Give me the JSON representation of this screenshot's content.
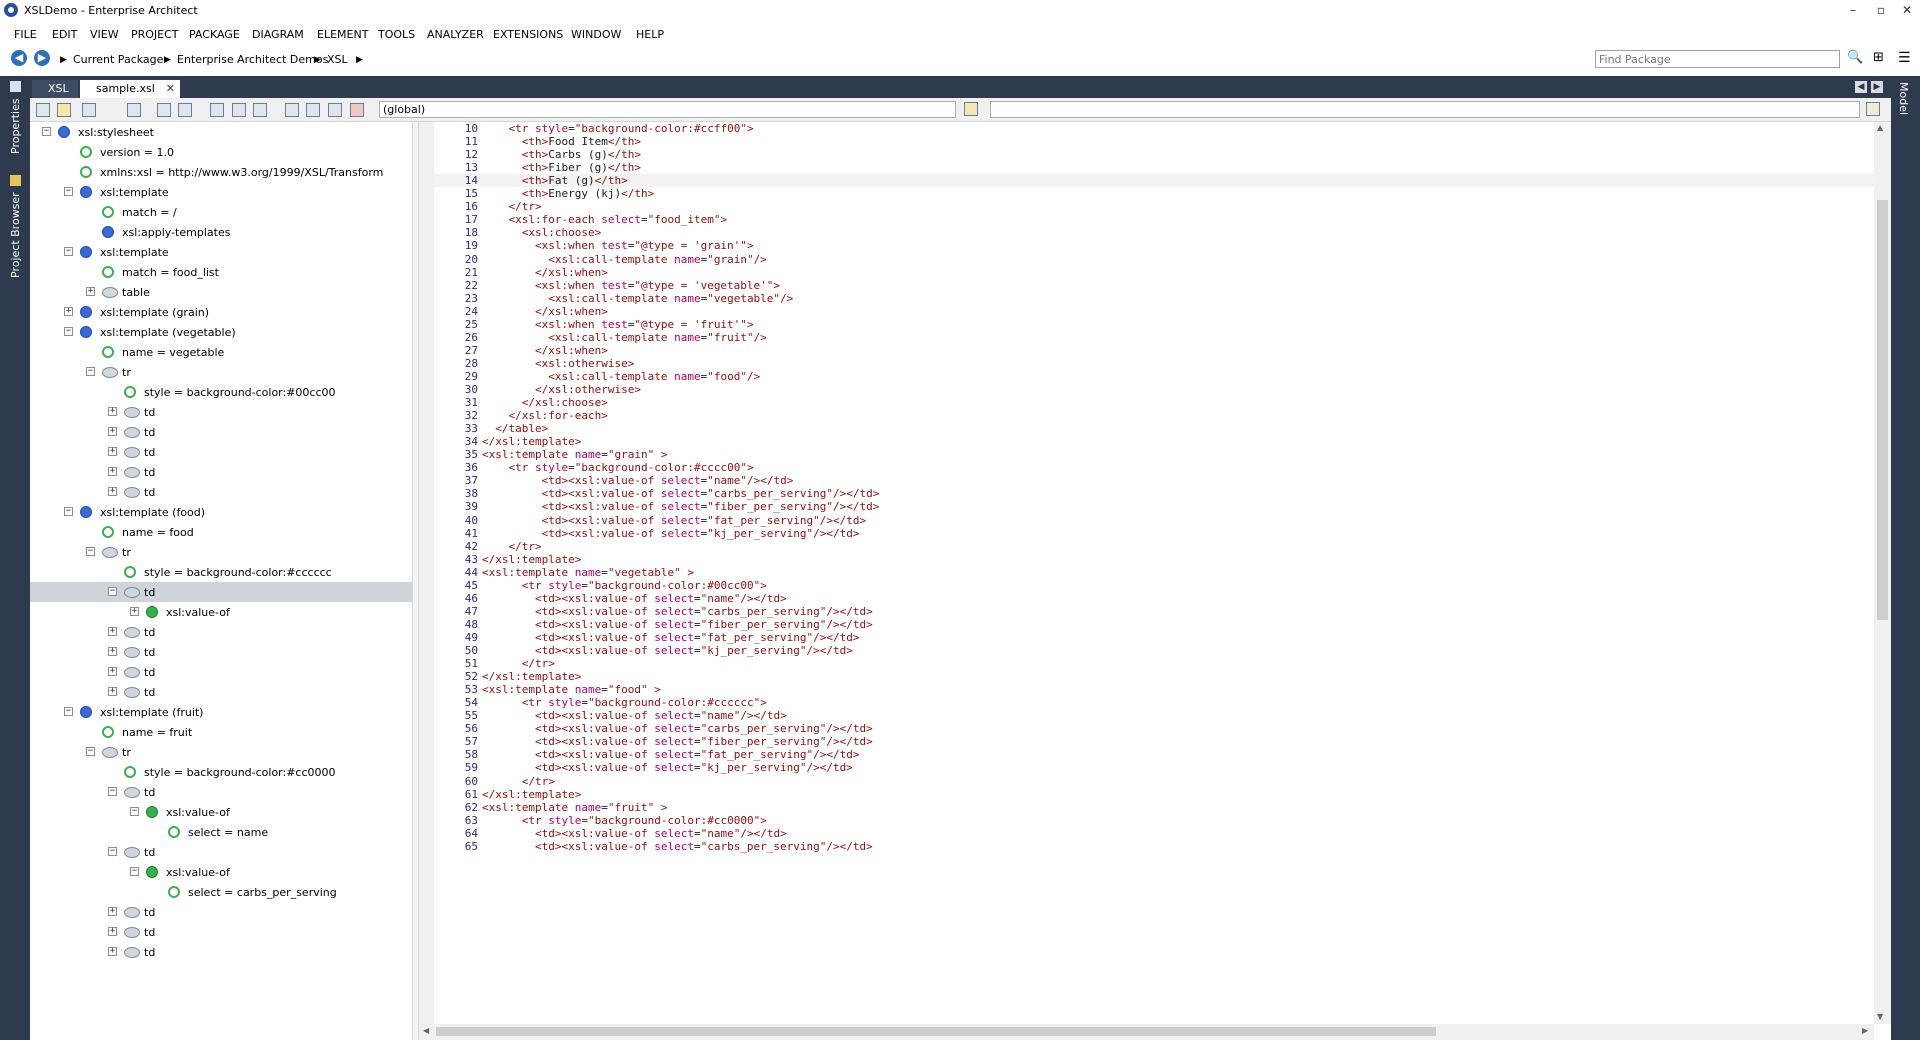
{
  "window": {
    "title": "XSLDemo - Enterprise Architect",
    "minimize": "–",
    "restore": "▫",
    "close": "✕"
  },
  "menu": [
    "FILE",
    "EDIT",
    "VIEW",
    "PROJECT",
    "PACKAGE",
    "DIAGRAM",
    "ELEMENT",
    "TOOLS",
    "ANALYZER",
    "EXTENSIONS",
    "WINDOW",
    "HELP"
  ],
  "breadcrumb": {
    "items": [
      "Current Package",
      "Enterprise Architect Demos",
      "XSL"
    ],
    "find_placeholder": "Find Package"
  },
  "left_rail": {
    "properties": "Properties",
    "project_browser": "Project Browser"
  },
  "right_rail": {
    "model": "Model"
  },
  "tabs": [
    {
      "label": "XSL",
      "active": false
    },
    {
      "label": "sample.xsl",
      "active": true
    }
  ],
  "toolbar": {
    "scope": "(global)"
  },
  "tree": [
    {
      "label": "xsl:stylesheet",
      "depth": 0,
      "icon": "blue",
      "exp": "-"
    },
    {
      "label": "version = 1.0",
      "depth": 1,
      "icon": "green",
      "exp": ""
    },
    {
      "label": "xmlns:xsl = http://www.w3.org/1999/XSL/Transform",
      "depth": 1,
      "icon": "green",
      "exp": ""
    },
    {
      "label": "xsl:template",
      "depth": 1,
      "icon": "blue",
      "exp": "-"
    },
    {
      "label": "match = /",
      "depth": 2,
      "icon": "green",
      "exp": ""
    },
    {
      "label": "xsl:apply-templates",
      "depth": 2,
      "icon": "blue",
      "exp": ""
    },
    {
      "label": "xsl:template",
      "depth": 1,
      "icon": "blue",
      "exp": "-"
    },
    {
      "label": "match = food_list",
      "depth": 2,
      "icon": "green",
      "exp": ""
    },
    {
      "label": "table",
      "depth": 2,
      "icon": "gray",
      "exp": "+"
    },
    {
      "label": "xsl:template (grain)",
      "depth": 1,
      "icon": "blue",
      "exp": "+"
    },
    {
      "label": "xsl:template (vegetable)",
      "depth": 1,
      "icon": "blue",
      "exp": "-"
    },
    {
      "label": "name = vegetable",
      "depth": 2,
      "icon": "green",
      "exp": ""
    },
    {
      "label": "tr",
      "depth": 2,
      "icon": "gray",
      "exp": "-"
    },
    {
      "label": "style = background-color:#00cc00",
      "depth": 3,
      "icon": "green",
      "exp": ""
    },
    {
      "label": "td",
      "depth": 3,
      "icon": "gray",
      "exp": "+"
    },
    {
      "label": "td",
      "depth": 3,
      "icon": "gray",
      "exp": "+"
    },
    {
      "label": "td",
      "depth": 3,
      "icon": "gray",
      "exp": "+"
    },
    {
      "label": "td",
      "depth": 3,
      "icon": "gray",
      "exp": "+"
    },
    {
      "label": "td",
      "depth": 3,
      "icon": "gray",
      "exp": "+"
    },
    {
      "label": "xsl:template (food)",
      "depth": 1,
      "icon": "blue",
      "exp": "-"
    },
    {
      "label": "name = food",
      "depth": 2,
      "icon": "green",
      "exp": ""
    },
    {
      "label": "tr",
      "depth": 2,
      "icon": "gray",
      "exp": "-"
    },
    {
      "label": "style = background-color:#cccccc",
      "depth": 3,
      "icon": "green",
      "exp": ""
    },
    {
      "label": "td",
      "depth": 3,
      "icon": "gray",
      "exp": "-",
      "selected": true
    },
    {
      "label": "xsl:value-of",
      "depth": 4,
      "icon": "greenfill",
      "exp": "+"
    },
    {
      "label": "td",
      "depth": 3,
      "icon": "gray",
      "exp": "+"
    },
    {
      "label": "td",
      "depth": 3,
      "icon": "gray",
      "exp": "+"
    },
    {
      "label": "td",
      "depth": 3,
      "icon": "gray",
      "exp": "+"
    },
    {
      "label": "td",
      "depth": 3,
      "icon": "gray",
      "exp": "+"
    },
    {
      "label": "xsl:template (fruit)",
      "depth": 1,
      "icon": "blue",
      "exp": "-"
    },
    {
      "label": "name = fruit",
      "depth": 2,
      "icon": "green",
      "exp": ""
    },
    {
      "label": "tr",
      "depth": 2,
      "icon": "gray",
      "exp": "-"
    },
    {
      "label": "style = background-color:#cc0000",
      "depth": 3,
      "icon": "green",
      "exp": ""
    },
    {
      "label": "td",
      "depth": 3,
      "icon": "gray",
      "exp": "-"
    },
    {
      "label": "xsl:value-of",
      "depth": 4,
      "icon": "greenfill",
      "exp": "-"
    },
    {
      "label": "select = name",
      "depth": 5,
      "icon": "green",
      "exp": ""
    },
    {
      "label": "td",
      "depth": 3,
      "icon": "gray",
      "exp": "-"
    },
    {
      "label": "xsl:value-of",
      "depth": 4,
      "icon": "greenfill",
      "exp": "-"
    },
    {
      "label": "select = carbs_per_serving",
      "depth": 5,
      "icon": "green",
      "exp": ""
    },
    {
      "label": "td",
      "depth": 3,
      "icon": "gray",
      "exp": "+"
    },
    {
      "label": "td",
      "depth": 3,
      "icon": "gray",
      "exp": "+"
    },
    {
      "label": "td",
      "depth": 3,
      "icon": "gray",
      "exp": "+"
    }
  ],
  "code": {
    "current_line": 14,
    "lines": [
      {
        "n": 10,
        "text": "    <tr style=\"background-color:#ccff00\">"
      },
      {
        "n": 11,
        "text": "      <th>Food Item</th>"
      },
      {
        "n": 12,
        "text": "      <th>Carbs (g)</th>"
      },
      {
        "n": 13,
        "text": "      <th>Fiber (g)</th>"
      },
      {
        "n": 14,
        "text": "      <th>Fat (g)</th>"
      },
      {
        "n": 15,
        "text": "      <th>Energy (kj)</th>"
      },
      {
        "n": 16,
        "text": "    </tr>"
      },
      {
        "n": 17,
        "text": "    <xsl:for-each select=\"food_item\">"
      },
      {
        "n": 18,
        "text": "      <xsl:choose>"
      },
      {
        "n": 19,
        "text": "        <xsl:when test=\"@type = 'grain'\">"
      },
      {
        "n": 20,
        "text": "          <xsl:call-template name=\"grain\"/>"
      },
      {
        "n": 21,
        "text": "        </xsl:when>"
      },
      {
        "n": 22,
        "text": "        <xsl:when test=\"@type = 'vegetable'\">"
      },
      {
        "n": 23,
        "text": "          <xsl:call-template name=\"vegetable\"/>"
      },
      {
        "n": 24,
        "text": "        </xsl:when>"
      },
      {
        "n": 25,
        "text": "        <xsl:when test=\"@type = 'fruit'\">"
      },
      {
        "n": 26,
        "text": "          <xsl:call-template name=\"fruit\"/>"
      },
      {
        "n": 27,
        "text": "        </xsl:when>"
      },
      {
        "n": 28,
        "text": "        <xsl:otherwise>"
      },
      {
        "n": 29,
        "text": "          <xsl:call-template name=\"food\"/>"
      },
      {
        "n": 30,
        "text": "        </xsl:otherwise>"
      },
      {
        "n": 31,
        "text": "      </xsl:choose>"
      },
      {
        "n": 32,
        "text": "    </xsl:for-each>"
      },
      {
        "n": 33,
        "text": "  </table>"
      },
      {
        "n": 34,
        "text": "</xsl:template>"
      },
      {
        "n": 35,
        "text": "<xsl:template name=\"grain\" >"
      },
      {
        "n": 36,
        "text": "    <tr style=\"background-color:#cccc00\">"
      },
      {
        "n": 37,
        "text": "         <td><xsl:value-of select=\"name\"/></td>"
      },
      {
        "n": 38,
        "text": "         <td><xsl:value-of select=\"carbs_per_serving\"/></td>"
      },
      {
        "n": 39,
        "text": "         <td><xsl:value-of select=\"fiber_per_serving\"/></td>"
      },
      {
        "n": 40,
        "text": "         <td><xsl:value-of select=\"fat_per_serving\"/></td>"
      },
      {
        "n": 41,
        "text": "         <td><xsl:value-of select=\"kj_per_serving\"/></td>"
      },
      {
        "n": 42,
        "text": "    </tr>"
      },
      {
        "n": 43,
        "text": "</xsl:template>"
      },
      {
        "n": 44,
        "text": "<xsl:template name=\"vegetable\" >"
      },
      {
        "n": 45,
        "text": "      <tr style=\"background-color:#00cc00\">"
      },
      {
        "n": 46,
        "text": "        <td><xsl:value-of select=\"name\"/></td>"
      },
      {
        "n": 47,
        "text": "        <td><xsl:value-of select=\"carbs_per_serving\"/></td>"
      },
      {
        "n": 48,
        "text": "        <td><xsl:value-of select=\"fiber_per_serving\"/></td>"
      },
      {
        "n": 49,
        "text": "        <td><xsl:value-of select=\"fat_per_serving\"/></td>"
      },
      {
        "n": 50,
        "text": "        <td><xsl:value-of select=\"kj_per_serving\"/></td>"
      },
      {
        "n": 51,
        "text": "      </tr>"
      },
      {
        "n": 52,
        "text": "</xsl:template>"
      },
      {
        "n": 53,
        "text": "<xsl:template name=\"food\" >"
      },
      {
        "n": 54,
        "text": "      <tr style=\"background-color:#cccccc\">"
      },
      {
        "n": 55,
        "text": "        <td><xsl:value-of select=\"name\"/></td>"
      },
      {
        "n": 56,
        "text": "        <td><xsl:value-of select=\"carbs_per_serving\"/></td>"
      },
      {
        "n": 57,
        "text": "        <td><xsl:value-of select=\"fiber_per_serving\"/></td>"
      },
      {
        "n": 58,
        "text": "        <td><xsl:value-of select=\"fat_per_serving\"/></td>"
      },
      {
        "n": 59,
        "text": "        <td><xsl:value-of select=\"kj_per_serving\"/></td>"
      },
      {
        "n": 60,
        "text": "      </tr>"
      },
      {
        "n": 61,
        "text": "</xsl:template>"
      },
      {
        "n": 62,
        "text": "<xsl:template name=\"fruit\" >"
      },
      {
        "n": 63,
        "text": "      <tr style=\"background-color:#cc0000\">"
      },
      {
        "n": 64,
        "text": "        <td><xsl:value-of select=\"name\"/></td>"
      },
      {
        "n": 65,
        "text": "        <td><xsl:value-of select=\"carbs_per_serving\"/></td>"
      }
    ]
  }
}
